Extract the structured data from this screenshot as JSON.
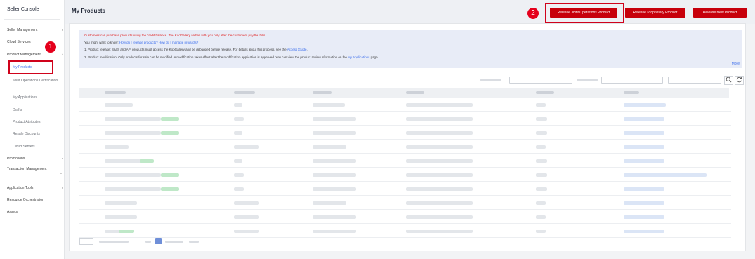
{
  "sidebar": {
    "title": "Seller Console",
    "items": [
      {
        "label": "Seller Management",
        "chevron": "v"
      },
      {
        "label": "Cloud Services",
        "chevron": ""
      },
      {
        "label": "Product Management",
        "chevron": "^"
      },
      {
        "label": "Promotions",
        "chevron": "v"
      },
      {
        "label": "Transaction Management",
        "chevron": "v"
      },
      {
        "label": "Application Tools",
        "chevron": "v"
      },
      {
        "label": "Resource Orchestration",
        "chevron": ""
      },
      {
        "label": "Assets",
        "chevron": ""
      }
    ],
    "subitems": [
      "My Products",
      "Joint Operations Certification",
      "My Applications",
      "Drafts",
      "Product Attributes",
      "Resale Discounts",
      "Cloud Servers"
    ]
  },
  "steps": {
    "one": "1",
    "two": "2"
  },
  "header": {
    "title": "My Products",
    "buttons": {
      "joint": "Release Joint Operations Product",
      "proprietary": "Release Proprietary Product",
      "new": "Release New Product"
    }
  },
  "notice": {
    "line1": "Customers can purchase products using the credit balance. The KooGallery settles with you only after the customers pay the bills.",
    "line2_prefix": "You might want to know: ",
    "line2_link1": "How do I release products?",
    "line2_link2": "How do I manage products?",
    "line3_prefix": "1. Product release: SaaS and API products must access the KooGallery and be debugged before release. For details about this process, see the ",
    "line3_link": "Access Guide",
    "line3_suffix": ".",
    "line4_prefix": "2. Product modification: Only products for sale can be modified. A modification takes effect after the modification application is approved. You can view the product review information on the ",
    "line4_link": "My Applications",
    "line4_suffix": " page.",
    "more": "More"
  },
  "toolbar": {
    "search_icon": "search-icon",
    "refresh_icon": "refresh-icon"
  },
  "colors": {
    "accent": "#c7000b",
    "highlight": "#d0021b",
    "link": "#3c6eec",
    "notice_bg": "#e8ecf7"
  }
}
